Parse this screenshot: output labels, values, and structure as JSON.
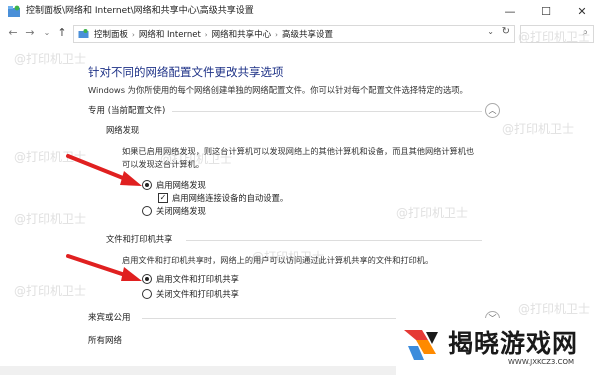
{
  "window": {
    "title": "控制面板\\网络和 Internet\\网络和共享中心\\高级共享设置",
    "minimize": "—",
    "maximize": "☐",
    "close": "✕"
  },
  "nav": {
    "back": "←",
    "forward": "→",
    "recent": "⌄",
    "up": "↑"
  },
  "address": {
    "crumbs": [
      "控制面板",
      "网络和 Internet",
      "网络和共享中心",
      "高级共享设置"
    ],
    "sep": "›",
    "dropdown": "⌄",
    "refresh": "↻"
  },
  "search": {
    "icon": "⌕"
  },
  "watermark": "@打印机卫士",
  "content": {
    "heading": "针对不同的网络配置文件更改共享选项",
    "description": "Windows 为你所使用的每个网络创建单独的网络配置文件。你可以针对每个配置文件选择特定的选项。"
  },
  "sections": {
    "private": {
      "title": "专用 (当前配置文件)",
      "network_discovery": {
        "title": "网络发现",
        "desc_line1": "如果已启用网络发现，则这台计算机可以发现网络上的其他计算机和设备，而且其他网络计算机也",
        "desc_line2": "可以发现这台计算机。",
        "opt_on": "启用网络发现",
        "auto_setup": "启用网络连接设备的自动设置。",
        "opt_off": "关闭网络发现"
      },
      "file_sharing": {
        "title": "文件和打印机共享",
        "desc": "启用文件和打印机共享时，网络上的用户可以访问通过此计算机共享的文件和打印机。",
        "opt_on": "启用文件和打印机共享",
        "opt_off": "关闭文件和打印机共享"
      }
    },
    "guest": {
      "title": "来宾或公用"
    },
    "all": {
      "title": "所有网络"
    }
  },
  "logo": {
    "text": "揭晓游戏网",
    "url": "WWW.JXKCZ3.COM"
  },
  "colors": {
    "heading": "#1e3287",
    "arrow": "#e02020"
  }
}
